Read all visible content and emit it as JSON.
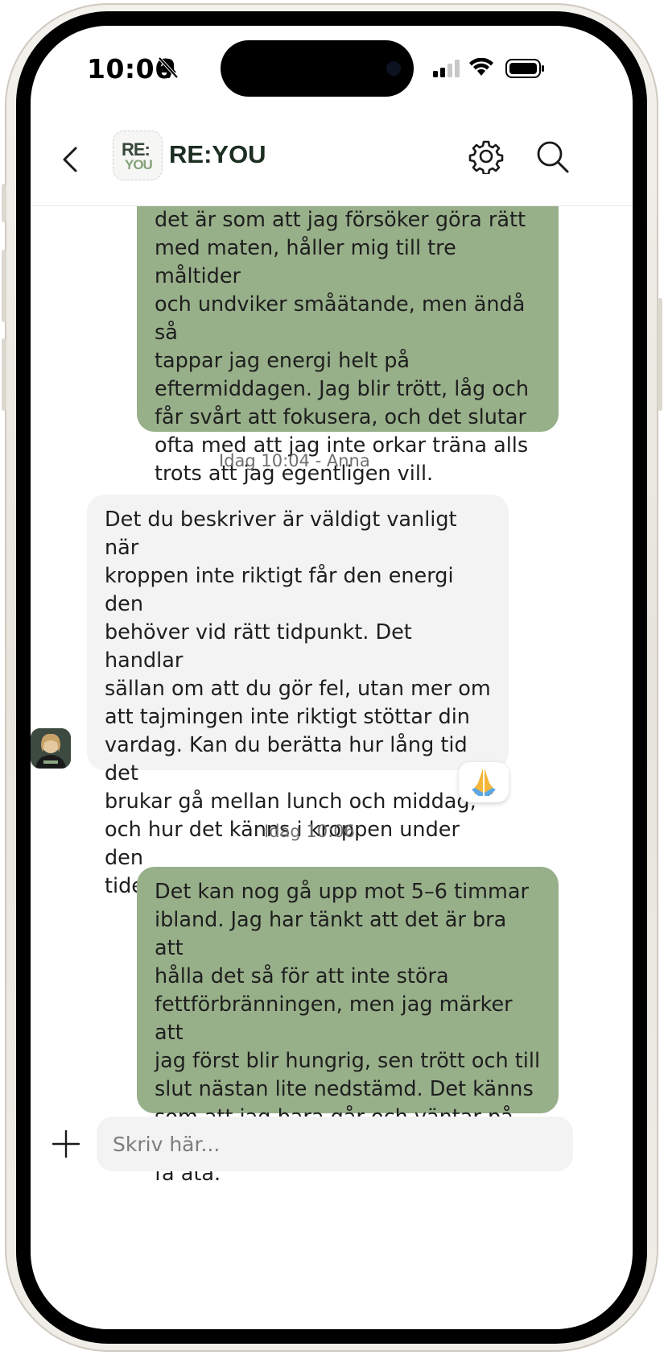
{
  "status_bar": {
    "time": "10:06"
  },
  "header": {
    "logo_top": "RE:",
    "logo_bottom": "YOU",
    "title": "RE:YOU"
  },
  "messages": [
    {
      "direction": "outgoing",
      "text": "det är som att jag försöker göra rätt\nmed maten, håller mig till tre måltider\noch undviker småätande, men ändå så\ntappar jag energi helt på\neftermiddagen. Jag blir trött, låg och\nfår svårt att fokusera, och det slutar\nofta med att jag inte orkar träna alls\ntrots att jag egentligen vill."
    },
    {
      "direction": "incoming",
      "timestamp": "Idag 10:04 - Anna",
      "text": "Det du beskriver är väldigt vanligt när\nkroppen inte riktigt får den energi den\nbehöver vid rätt tidpunkt. Det handlar\nsällan om att du gör fel, utan mer om\natt tajmingen inte riktigt stöttar din\nvardag. Kan du berätta hur lång tid det\nbrukar gå mellan lunch och middag,\noch hur det känns i kroppen under den\ntiden?",
      "reaction": "praying-hands"
    },
    {
      "direction": "outgoing",
      "timestamp": "Idag 10:06",
      "text": "Det kan nog gå upp mot 5–6 timmar\nibland. Jag har tänkt att det är bra att\nhålla det så för att inte störa\nfettförbränningen, men jag märker att\njag först blir hungrig, sen trött och till\nslut nästan lite nedstämd. Det känns\nsom att jag bara går och väntar på att\nfå äta."
    }
  ],
  "composer": {
    "placeholder": "Skriv här..."
  },
  "colors": {
    "outgoing_bubble": "#98b08a",
    "incoming_bubble": "#f3f3f3",
    "title": "#1c2d21"
  }
}
